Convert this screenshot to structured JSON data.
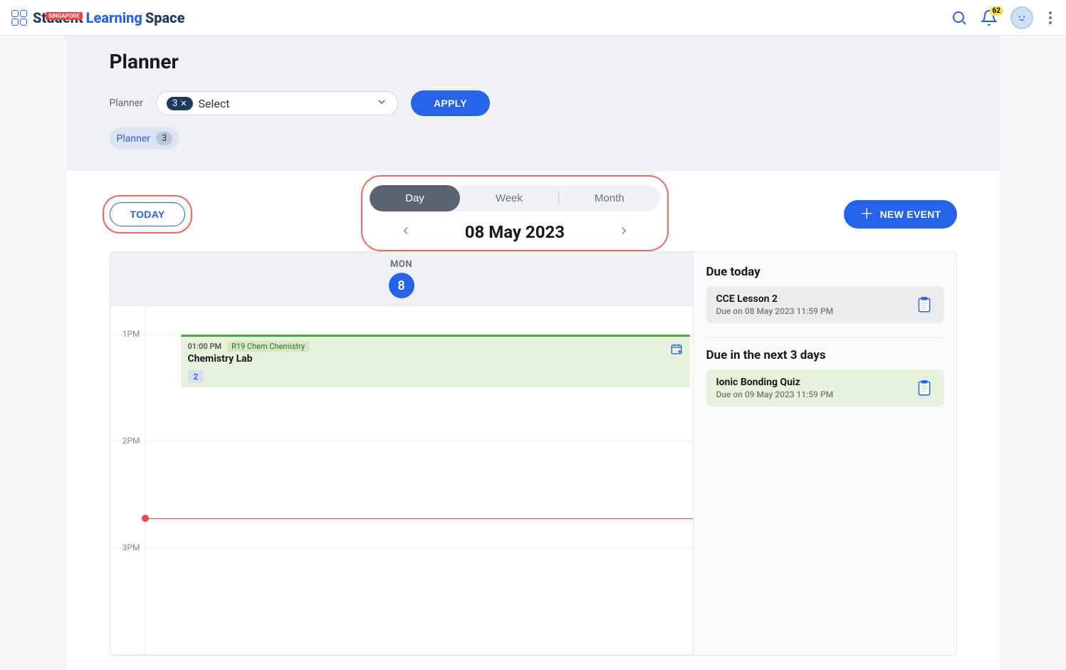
{
  "header": {
    "badge": "SINGAPORE",
    "logo_w1": "Student",
    "logo_w2": "Learning",
    "logo_w3": "Space",
    "notif_count": "62"
  },
  "page": {
    "title": "Planner",
    "filter_label": "Planner",
    "select_count": "3",
    "select_placeholder": "Select",
    "apply": "APPLY",
    "chip_label": "Planner",
    "chip_count": "3"
  },
  "controls": {
    "today": "TODAY",
    "view_day": "Day",
    "view_week": "Week",
    "view_month": "Month",
    "current_date": "08 May 2023",
    "new_event": "NEW EVENT"
  },
  "calendar": {
    "dow": "MON",
    "dom": "8",
    "hours": [
      "1PM",
      "2PM",
      "3PM"
    ],
    "event": {
      "time": "01:00 PM",
      "tag": "R19 Chem Chemistry",
      "title": "Chemistry Lab",
      "badge": "2"
    }
  },
  "side": {
    "due_today_heading": "Due today",
    "due_today": {
      "title": "CCE Lesson 2",
      "meta": "Due on 08 May 2023 11:59 PM"
    },
    "due_next_heading": "Due in the next 3 days",
    "due_next": {
      "title": "Ionic Bonding Quiz",
      "meta": "Due on 09 May 2023 11:59 PM"
    }
  }
}
